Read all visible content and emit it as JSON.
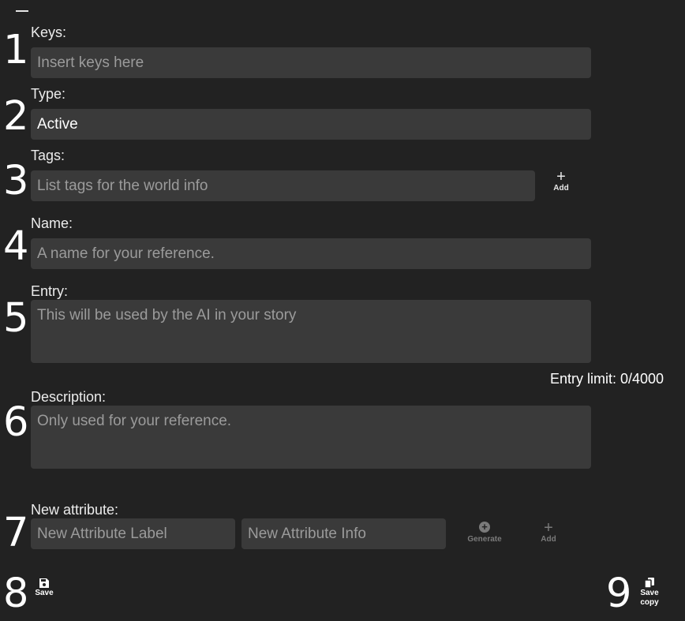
{
  "numbers": [
    "1",
    "2",
    "3",
    "4",
    "5",
    "6",
    "7",
    "8",
    "9"
  ],
  "keys": {
    "label": "Keys:",
    "placeholder": "Insert keys here"
  },
  "type": {
    "label": "Type:",
    "value": "Active"
  },
  "tags": {
    "label": "Tags:",
    "placeholder": "List tags for the world info",
    "add_label": "Add"
  },
  "name": {
    "label": "Name:",
    "placeholder": "A name for your reference."
  },
  "entry": {
    "label": "Entry:",
    "placeholder": "This will be used by the AI in your story",
    "limit": "Entry limit: 0/4000"
  },
  "description": {
    "label": "Description:",
    "placeholder": "Only used for your reference."
  },
  "new_attribute": {
    "label": "New attribute:",
    "label_placeholder": "New Attribute Label",
    "info_placeholder": "New Attribute Info",
    "generate_label": "Generate",
    "add_label": "Add"
  },
  "footer": {
    "save_label": "Save",
    "save_copy_label_1": "Save",
    "save_copy_label_2": "copy"
  },
  "icons": {
    "minimize": "minimize-icon",
    "add": "plus-icon",
    "generate": "plus-circle-icon",
    "save": "floppy-disk-icon",
    "save_copy": "copy-icon"
  },
  "colors": {
    "background": "#222222",
    "field": "#3a3a3a",
    "placeholder": "#9b9b9b",
    "text": "#ffffff"
  }
}
